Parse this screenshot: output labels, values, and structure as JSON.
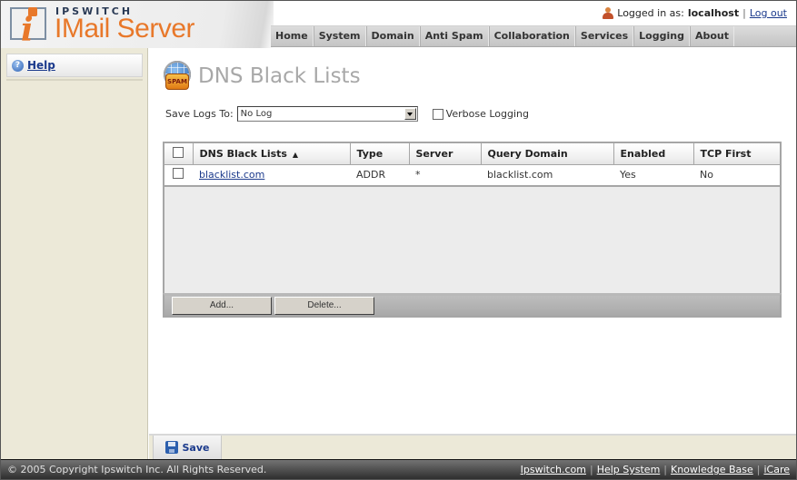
{
  "header": {
    "brand": "IPSWITCH",
    "product": "IMail Server",
    "logged_in_label": "Logged in as:",
    "username": "localhost",
    "separator": "|",
    "logout_label": "Log out"
  },
  "nav": {
    "items": [
      {
        "label": "Home"
      },
      {
        "label": "System"
      },
      {
        "label": "Domain"
      },
      {
        "label": "Anti Spam"
      },
      {
        "label": "Collaboration"
      },
      {
        "label": "Services"
      },
      {
        "label": "Logging"
      },
      {
        "label": "About"
      }
    ]
  },
  "sidebar": {
    "help_icon_glyph": "?",
    "help_label": "Help"
  },
  "page": {
    "icon_label": "SPAM",
    "title": "DNS Black Lists",
    "save_logs_label": "Save Logs To:",
    "save_logs_value": "No Log",
    "verbose_label": "Verbose Logging",
    "verbose_checked": false
  },
  "table": {
    "columns": [
      {
        "label": "DNS Black Lists",
        "sort": "▲"
      },
      {
        "label": "Type"
      },
      {
        "label": "Server"
      },
      {
        "label": "Query Domain"
      },
      {
        "label": "Enabled"
      },
      {
        "label": "TCP First"
      }
    ],
    "rows": [
      {
        "name": "blacklist.com",
        "type": "ADDR",
        "server": "*",
        "query_domain": "blacklist.com",
        "enabled": "Yes",
        "tcp_first": "No"
      }
    ],
    "add_label": "Add...",
    "delete_label": "Delete..."
  },
  "savebar": {
    "save_label": "Save"
  },
  "footer": {
    "copyright": "© 2005 Copyright Ipswitch Inc. All Rights Reserved.",
    "links": [
      {
        "label": "Ipswitch.com"
      },
      {
        "label": "Help System"
      },
      {
        "label": "Knowledge Base"
      },
      {
        "label": "iCare"
      }
    ],
    "separator": "|"
  },
  "colors": {
    "accent_orange": "#e8782a",
    "link_blue": "#1b3a8c",
    "sidebar_bg": "#ece9d8",
    "title_gray": "#a8a8a8"
  }
}
